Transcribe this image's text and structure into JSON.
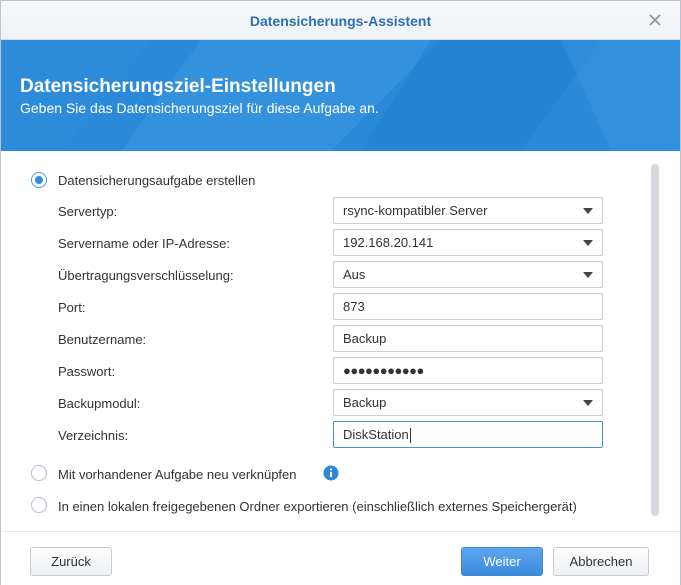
{
  "window": {
    "title": "Datensicherungs-Assistent",
    "close_icon": "close-icon"
  },
  "banner": {
    "title": "Datensicherungsziel-Einstellungen",
    "subtitle": "Geben Sie das Datensicherungsziel für diese Aufgabe an.",
    "color": "#2a8ad9"
  },
  "options": [
    {
      "label": "Datensicherungsaufgabe erstellen",
      "selected": true
    },
    {
      "label": "Mit vorhandener Aufgabe neu verknüpfen",
      "selected": false,
      "icon": "info-icon"
    },
    {
      "label": "In einen lokalen freigegebenen Ordner exportieren (einschließlich externes Speichergerät)",
      "selected": false
    }
  ],
  "form": {
    "server_type": {
      "label": "Servertyp:",
      "value": "rsync-kompatibler Server"
    },
    "server_name": {
      "label": "Servername oder IP-Adresse:",
      "value": "192.168.20.141"
    },
    "encryption": {
      "label": "Übertragungsverschlüsselung:",
      "value": "Aus"
    },
    "port": {
      "label": "Port:",
      "value": "873"
    },
    "username": {
      "label": "Benutzername:",
      "value": "Backup"
    },
    "password": {
      "label": "Passwort:",
      "value": "●●●●●●●●●●●"
    },
    "backup_module": {
      "label": "Backupmodul:",
      "value": "Backup"
    },
    "directory": {
      "label": "Verzeichnis:",
      "value": "DiskStation"
    }
  },
  "buttons": {
    "back": "Zurück",
    "next": "Weiter",
    "cancel": "Abbrechen"
  },
  "colors": {
    "accent": "#2a8ad9",
    "title_text": "#2d6fb2",
    "primary_button": "#3a8be0"
  }
}
